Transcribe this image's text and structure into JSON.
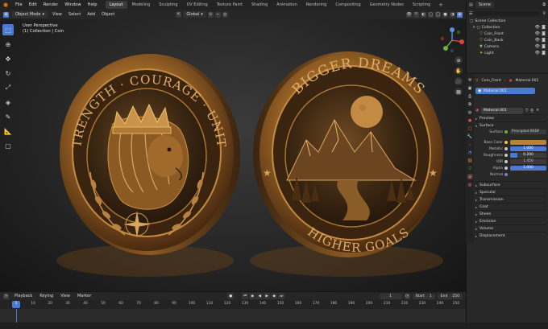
{
  "topbar": {
    "menus": [
      "File",
      "Edit",
      "Render",
      "Window",
      "Help"
    ],
    "tabs": [
      "Layout",
      "Modeling",
      "Sculpting",
      "UV Editing",
      "Texture Paint",
      "Shading",
      "Animation",
      "Rendering",
      "Compositing",
      "Geometry Nodes",
      "Scripting"
    ],
    "active_tab": "Layout",
    "add_tab": "+",
    "scene_label": "Scene"
  },
  "viewport_header": {
    "mode": "Object Mode",
    "menus": [
      "View",
      "Select",
      "Add",
      "Object"
    ],
    "transform": "Global"
  },
  "viewport": {
    "perspective": "User Perspective",
    "collection_info": "(1) Collection | Coin"
  },
  "coin_left": {
    "top_text": "STRENGTH · COURAGE · UNITY"
  },
  "coin_right": {
    "top_text": "BIGGER DREAMS",
    "bottom_text": "HIGHER GOALS"
  },
  "outliner": {
    "title": "Scene Collection",
    "items": [
      {
        "label": "Collection",
        "indent": 0
      },
      {
        "label": "Coin_Front",
        "indent": 1
      },
      {
        "label": "Coin_Back",
        "indent": 1
      },
      {
        "label": "Camera",
        "indent": 1
      },
      {
        "label": "Light",
        "indent": 1
      }
    ]
  },
  "properties": {
    "object_name": "Coin_Front",
    "material_tab": "Material.001",
    "slot": "Material.001",
    "material_name": "Material.001",
    "preview": "Preview",
    "surface": "Surface",
    "surface_key": "Surface",
    "bsdf": "Principled BSDF",
    "rows": [
      {
        "label": "Base Color",
        "value": ""
      },
      {
        "label": "Metallic",
        "value": "1.000"
      },
      {
        "label": "Roughness",
        "value": "0.200"
      },
      {
        "label": "IOR",
        "value": "1.450"
      },
      {
        "label": "Alpha",
        "value": "1.000"
      },
      {
        "label": "Normal",
        "value": ""
      }
    ],
    "sections": [
      "Subsurface",
      "Specular",
      "Transmission",
      "Coat",
      "Sheen",
      "Emission",
      "Volume",
      "Displacement"
    ]
  },
  "timeline": {
    "menus": [
      "Playback",
      "Keying",
      "View",
      "Marker"
    ],
    "current_frame": "1",
    "start_label": "Start",
    "start": "1",
    "end_label": "End",
    "end": "250",
    "ticks": [
      "1",
      "10",
      "20",
      "30",
      "40",
      "50",
      "60",
      "70",
      "80",
      "90",
      "100",
      "110",
      "120",
      "130",
      "140",
      "150",
      "160",
      "170",
      "180",
      "190",
      "200",
      "210",
      "220",
      "230",
      "240",
      "250"
    ]
  },
  "colors": {
    "accent": "#4a7bd1",
    "brand": "#e87d0d",
    "gold": "#b88434"
  }
}
